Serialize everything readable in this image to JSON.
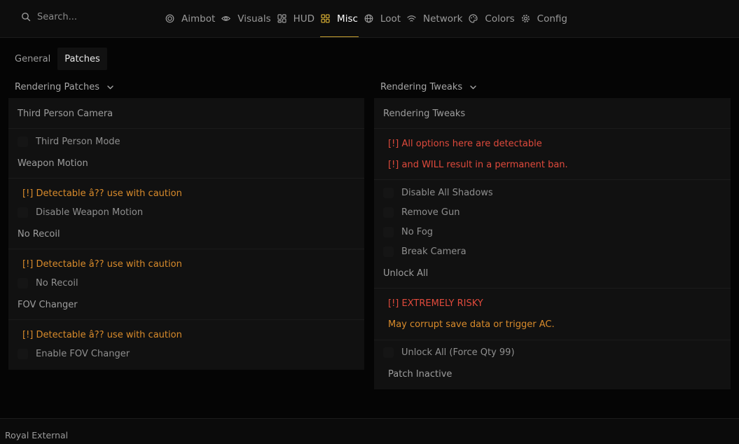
{
  "search": {
    "placeholder": "Search..."
  },
  "nav": {
    "items": [
      {
        "label": "Aimbot",
        "icon": "target-icon"
      },
      {
        "label": "Visuals",
        "icon": "eye-icon"
      },
      {
        "label": "HUD",
        "icon": "hud-grid-icon"
      },
      {
        "label": "Misc",
        "icon": "apps-grid-icon",
        "active": true
      },
      {
        "label": "Loot",
        "icon": "globe-icon"
      },
      {
        "label": "Network",
        "icon": "wifi-icon"
      },
      {
        "label": "Colors",
        "icon": "palette-icon"
      },
      {
        "label": "Config",
        "icon": "gear-icon"
      }
    ],
    "active_color": "#c9a230"
  },
  "subtabs": [
    "General",
    "Patches"
  ],
  "left": {
    "header": "Rendering Patches",
    "panel_title": "Third Person Camera",
    "third_person_mode": "Third Person Mode",
    "weapon_motion": {
      "title": "Weapon Motion",
      "warning": "[!] Detectable â?? use with caution",
      "option": "Disable Weapon Motion"
    },
    "no_recoil": {
      "title": "No Recoil",
      "warning": "[!] Detectable â?? use with caution",
      "option": "No Recoil"
    },
    "fov_changer": {
      "title": "FOV Changer",
      "warning": "[!] Detectable â?? use with caution",
      "option": "Enable FOV Changer"
    }
  },
  "right": {
    "header": "Rendering Tweaks",
    "panel_title": "Rendering Tweaks",
    "warning_1": "[!] All options here are detectable",
    "warning_2": "[!] and WILL result in a permanent ban.",
    "options": [
      "Disable All Shadows",
      "Remove Gun",
      "No Fog",
      "Break Camera"
    ],
    "unlock_all": {
      "title": "Unlock All",
      "warning_red": "[!] EXTREMELY RISKY",
      "warning_orange": "May corrupt save data or trigger AC.",
      "option": "Unlock All (Force Qty 99)",
      "status": "Patch Inactive"
    }
  },
  "footer": {
    "label": "Royal External"
  },
  "colors": {
    "warn_orange": "#d98b2b",
    "warn_red": "#e04a3c"
  }
}
